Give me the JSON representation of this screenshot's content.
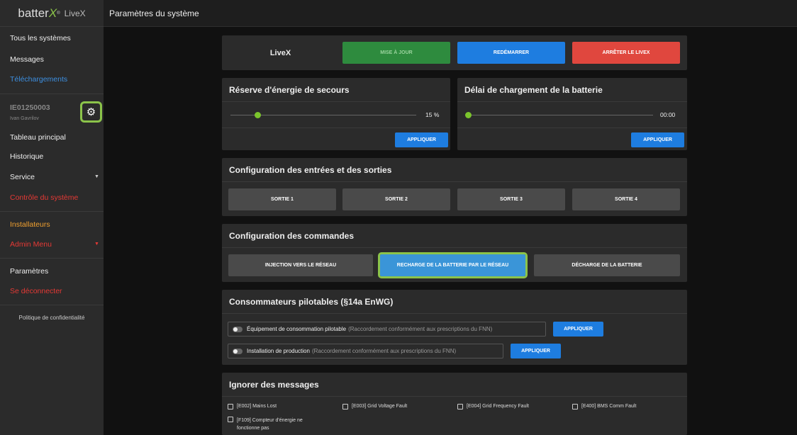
{
  "logo": {
    "brand": "batter",
    "x": "X",
    "reg": "®",
    "product": "LiveX"
  },
  "sidebar": {
    "all_systems": "Tous les systèmes",
    "messages": "Messages",
    "downloads": "Téléchargements",
    "device_id": "IE01250003",
    "device_user": "Ivan Gavrilov",
    "dashboard": "Tableau principal",
    "history": "Historique",
    "service": "Service",
    "system_control": "Contrôle du système",
    "installers": "Installateurs",
    "admin_menu": "Admin Menu",
    "settings": "Paramètres",
    "logout": "Se déconnecter",
    "privacy": "Politique de confidentialité"
  },
  "header": {
    "title": "Paramètres du système"
  },
  "livex": {
    "label": "LiveX",
    "update": "MISE À JOUR",
    "restart": "REDÉMARRER",
    "stop": "ARRÊTER LE LIVEX"
  },
  "reserve": {
    "title": "Réserve d'énergie de secours",
    "value": "15 %",
    "level": 0.15,
    "apply": "APPLIQUER"
  },
  "delay": {
    "title": "Délai de chargement de la batterie",
    "value": "00:00",
    "apply": "APPLIQUER"
  },
  "io": {
    "title": "Configuration des entrées et des sorties",
    "outputs": [
      "SORTIE 1",
      "SORTIE 2",
      "SORTIE 3",
      "SORTIE 4"
    ]
  },
  "commands": {
    "title": "Configuration des commandes",
    "injection": "INJECTION VERS LE RÉSEAU",
    "recharge": "RECHARGE DE LA BATTERIE PAR LE RÉSEAU",
    "discharge": "DÉCHARGE DE LA BATTERIE"
  },
  "consumers": {
    "title": "Consommateurs pilotables (§14a EnWG)",
    "item1": "Équipement de consommation pilotable",
    "item1_note": "(Raccordement conformément aux prescriptions du FNN)",
    "item2": "Installation de production",
    "item2_note": "(Raccordement conformément aux prescriptions du FNN)",
    "apply": "APPLIQUER"
  },
  "ignore": {
    "title": "Ignorer des messages",
    "items": [
      "[E002] Mains Lost",
      "[E003] Grid Voltage Fault",
      "[E004] Grid Frequency Fault",
      "[E400] BMS Comm Fault",
      "[F109] Compteur d'énergie ne fonctionne pas"
    ]
  }
}
